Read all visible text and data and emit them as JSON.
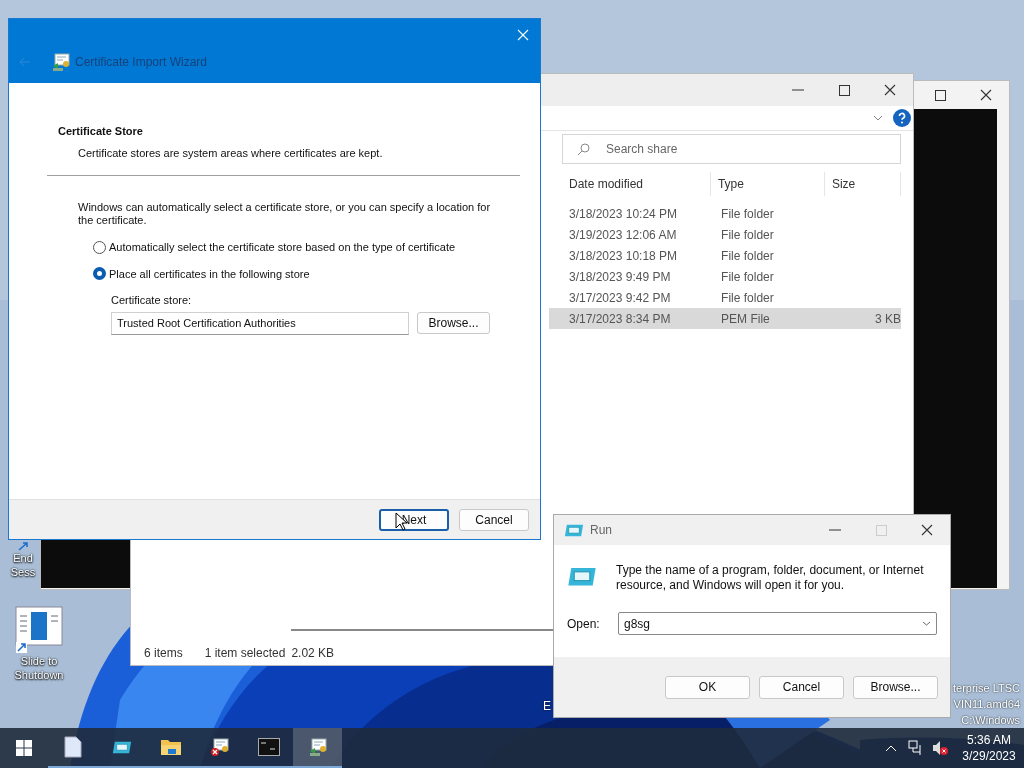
{
  "desktop_icons": [
    {
      "kind": "session",
      "lines": [
        "End",
        "Sess"
      ]
    },
    {
      "kind": "slide",
      "lines": [
        "Slide to",
        "Shutdown"
      ]
    }
  ],
  "desktop_text": {
    "fragment": "E",
    "lines": [
      "terprise LTSC",
      "VIN11.amd64",
      "C:\\Windows"
    ]
  },
  "explorer": {
    "search_placeholder": "Search share",
    "columns": [
      "Date modified",
      "Type",
      "Size"
    ],
    "rows": [
      {
        "date": "3/18/2023 10:24 PM",
        "type": "File folder",
        "size": "",
        "selected": false
      },
      {
        "date": "3/19/2023 12:06 AM",
        "type": "File folder",
        "size": "",
        "selected": false
      },
      {
        "date": "3/18/2023 10:18 PM",
        "type": "File folder",
        "size": "",
        "selected": false
      },
      {
        "date": "3/18/2023 9:49 PM",
        "type": "File folder",
        "size": "",
        "selected": false
      },
      {
        "date": "3/17/2023 9:42 PM",
        "type": "File folder",
        "size": "",
        "selected": false
      },
      {
        "date": "3/17/2023 8:34 PM",
        "type": "PEM File",
        "size": "3 KB",
        "selected": true
      }
    ],
    "status": [
      "6 items",
      "1 item selected",
      "2.02 KB"
    ]
  },
  "wizard": {
    "title": "Certificate Import Wizard",
    "heading": "Certificate Store",
    "subheading": "Certificate stores are system areas where certificates are kept.",
    "intro": "Windows can automatically select a certificate store, or you can specify a location for the certificate.",
    "options": [
      {
        "label": "Automatically select the certificate store based on the type of certificate",
        "selected": false
      },
      {
        "label": "Place all certificates in the following store",
        "selected": true
      }
    ],
    "store_label": "Certificate store:",
    "store_value": "Trusted Root Certification Authorities",
    "browse_button": "Browse...",
    "buttons": [
      {
        "label": "Next",
        "default": true
      },
      {
        "label": "Cancel",
        "default": false
      }
    ]
  },
  "run": {
    "title": "Run",
    "description": "Type the name of a program, folder, document, or Internet resource, and Windows will open it for you.",
    "open_label": "Open:",
    "open_value": "g8sg",
    "buttons": [
      "OK",
      "Cancel",
      "Browse..."
    ]
  },
  "taskbar": {
    "apps": [
      {
        "kind": "notepad",
        "active": false
      },
      {
        "kind": "run",
        "active": false
      },
      {
        "kind": "explorer",
        "active": false
      },
      {
        "kind": "cert-error",
        "active": false
      },
      {
        "kind": "terminal",
        "active": false
      },
      {
        "kind": "cert-import",
        "active": true
      }
    ],
    "clock": {
      "time": "5:36 AM",
      "date": "3/29/2023"
    }
  }
}
